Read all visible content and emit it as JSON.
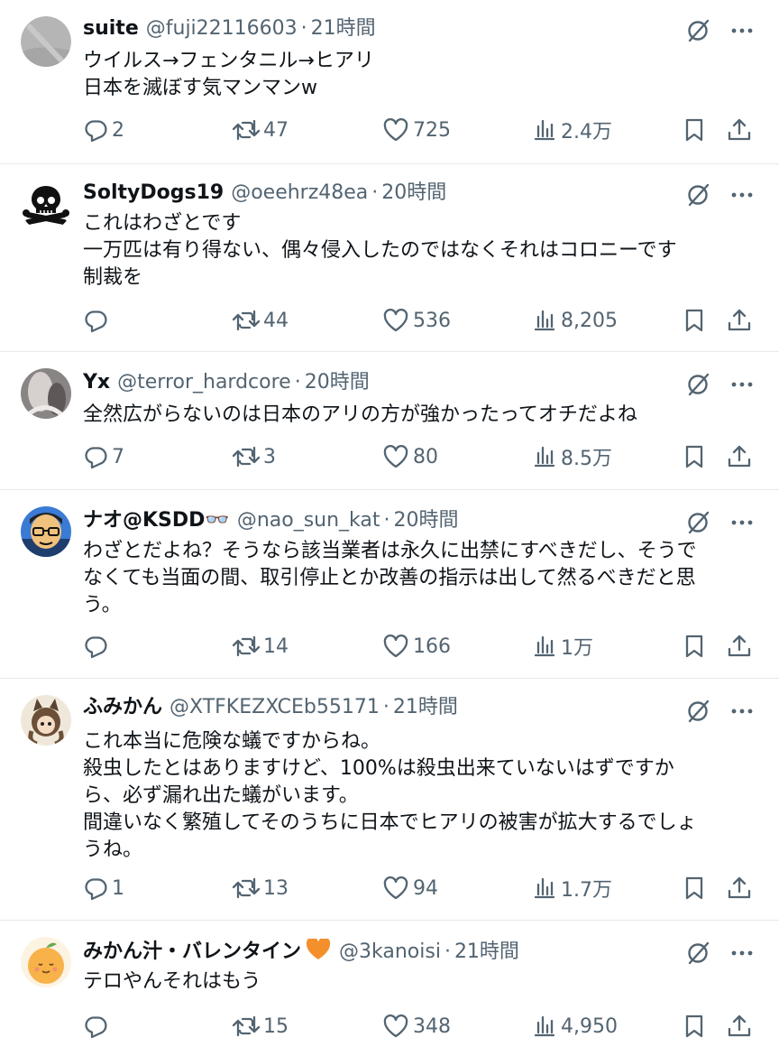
{
  "tweets": [
    {
      "name": "suite",
      "handle": "@fuji22116603",
      "sep": "·",
      "time": "21時間",
      "heart": "",
      "text": "ウイルス→フェンタニル→ヒアリ\n日本を滅ぼす気マンマンw",
      "replies": "2",
      "retweets": "47",
      "likes": "725",
      "views": "2.4万"
    },
    {
      "name": "SoltyDogs19",
      "handle": "@oeehrz48ea",
      "sep": "·",
      "time": "20時間",
      "heart": "",
      "text": "これはわざとです\n一万匹は有り得ない、偶々侵入したのではなくそれはコロニーです\n制裁を",
      "replies": "",
      "retweets": "44",
      "likes": "536",
      "views": "8,205"
    },
    {
      "name": "Yx",
      "handle": "@terror_hardcore",
      "sep": "·",
      "time": "20時間",
      "heart": "",
      "text": "全然広がらないのは日本のアリの方が強かったってオチだよね",
      "replies": "7",
      "retweets": "3",
      "likes": "80",
      "views": "8.5万"
    },
    {
      "name": "ナオ@KSDD👓",
      "handle": "@nao_sun_kat",
      "sep": "·",
      "time": "20時間",
      "heart": "",
      "text": "わざとだよね？そうなら該当業者は永久に出禁にすべきだし、そうで\nなくても当面の間、取引停止とか改善の指示は出して然るべきだと思\nう。",
      "replies": "",
      "retweets": "14",
      "likes": "166",
      "views": "1万"
    },
    {
      "name": "ふみかん",
      "handle": "@XTFKEZXCEb55171",
      "sep": "·",
      "time": "21時間",
      "heart": "",
      "text": "これ本当に危険な蟻ですからね。\n殺虫したとはありますけど、100%は殺虫出来ていないはずですか\nら、必ず漏れ出た蟻がいます。\n間違いなく繁殖してそのうちに日本でヒアリの被害が拡大するでしょ\nうね。",
      "replies": "1",
      "retweets": "13",
      "likes": "94",
      "views": "1.7万"
    },
    {
      "name": "みかん汁・バレンタイン",
      "handle": "@3kanoisi",
      "sep": "·",
      "time": "21時間",
      "heart": "🧡",
      "text": "テロやんそれはもう",
      "replies": "",
      "retweets": "15",
      "likes": "348",
      "views": "4,950"
    }
  ],
  "colors": {
    "text": "#0f1419",
    "secondary": "#536471",
    "divider": "#e7e9ea",
    "heart_badge": "#f4902c"
  },
  "icons": {
    "reply": "reply-icon",
    "retweet": "retweet-icon",
    "like": "heart-icon",
    "views": "views-icon",
    "bookmark": "bookmark-icon",
    "share": "share-icon",
    "grok": "grok-icon",
    "more": "more-icon"
  }
}
